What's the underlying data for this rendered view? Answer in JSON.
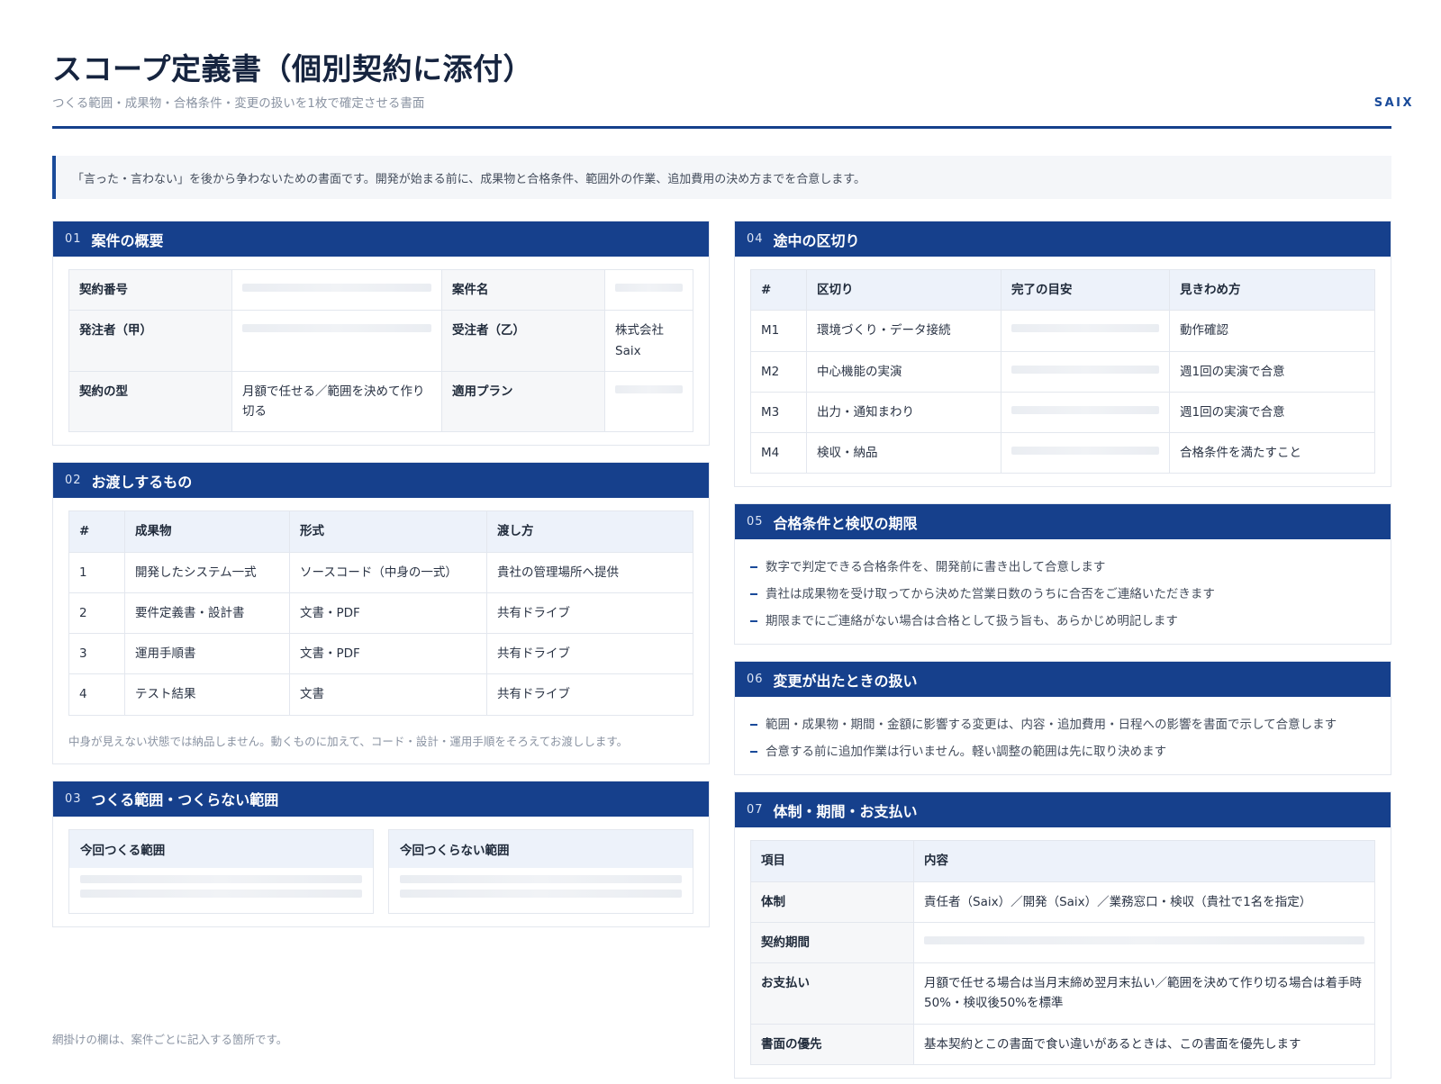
{
  "header": {
    "title": "スコープ定義書（個別契約に添付）",
    "subtitle": "つくる範囲・成果物・合格条件・変更の扱いを1枚で確定させる書面",
    "brand": "SAIX"
  },
  "intro": "「言った・言わない」を後から争わないための書面です。開発が始まる前に、成果物と合格条件、範囲外の作業、追加費用の決め方までを合意します。",
  "s01": {
    "num": "01",
    "title": "案件の概要",
    "rows": [
      {
        "l1": "契約番号",
        "v1": "",
        "l2": "案件名",
        "v2": ""
      },
      {
        "l1": "発注者（甲）",
        "v1": "",
        "l2": "受注者（乙）",
        "v2": "株式会社Saix"
      },
      {
        "l1": "契約の型",
        "v1": "月額で任せる／範囲を決めて作り切る",
        "l2": "適用プラン",
        "v2": ""
      }
    ]
  },
  "s02": {
    "num": "02",
    "title": "お渡しするもの",
    "headers": [
      "#",
      "成果物",
      "形式",
      "渡し方"
    ],
    "rows": [
      [
        "1",
        "開発したシステム一式",
        "ソースコード（中身の一式）",
        "貴社の管理場所へ提供"
      ],
      [
        "2",
        "要件定義書・設計書",
        "文書・PDF",
        "共有ドライブ"
      ],
      [
        "3",
        "運用手順書",
        "文書・PDF",
        "共有ドライブ"
      ],
      [
        "4",
        "テスト結果",
        "文書",
        "共有ドライブ"
      ]
    ],
    "note": "中身が見えない状態では納品しません。動くものに加えて、コード・設計・運用手順をそろえてお渡しします。"
  },
  "s03": {
    "num": "03",
    "title": "つくる範囲・つくらない範囲",
    "in_scope": "今回つくる範囲",
    "out_scope": "今回つくらない範囲"
  },
  "s04": {
    "num": "04",
    "title": "途中の区切り",
    "headers": [
      "#",
      "区切り",
      "完了の目安",
      "見きわめ方"
    ],
    "rows": [
      {
        "id": "M1",
        "name": "環境づくり・データ接続",
        "check": "動作確認"
      },
      {
        "id": "M2",
        "name": "中心機能の実演",
        "check": "週1回の実演で合意"
      },
      {
        "id": "M3",
        "name": "出力・通知まわり",
        "check": "週1回の実演で合意"
      },
      {
        "id": "M4",
        "name": "検収・納品",
        "check": "合格条件を満たすこと"
      }
    ]
  },
  "s05": {
    "num": "05",
    "title": "合格条件と検収の期限",
    "items": [
      "数字で判定できる合格条件を、開発前に書き出して合意します",
      "貴社は成果物を受け取ってから決めた営業日数のうちに合否をご連絡いただきます",
      "期限までにご連絡がない場合は合格として扱う旨も、あらかじめ明記します"
    ]
  },
  "s06": {
    "num": "06",
    "title": "変更が出たときの扱い",
    "items": [
      "範囲・成果物・期間・金額に影響する変更は、内容・追加費用・日程への影響を書面で示して合意します",
      "合意する前に追加作業は行いません。軽い調整の範囲は先に取り決めます"
    ]
  },
  "s07": {
    "num": "07",
    "title": "体制・期間・お支払い",
    "headers": [
      "項目",
      "内容"
    ],
    "rows": [
      {
        "label": "体制",
        "value": "責任者（Saix）／開発（Saix）／業務窓口・検収（貴社で1名を指定）"
      },
      {
        "label": "契約期間",
        "value": ""
      },
      {
        "label": "お支払い",
        "value": "月額で任せる場合は当月末締め翌月末払い／範囲を決めて作り切る場合は着手時50%・検収後50%を標準"
      },
      {
        "label": "書面の優先",
        "value": "基本契約とこの書面で食い違いがあるときは、この書面を優先します"
      }
    ]
  },
  "footer": "網掛けの欄は、案件ごとに記入する箇所です。"
}
